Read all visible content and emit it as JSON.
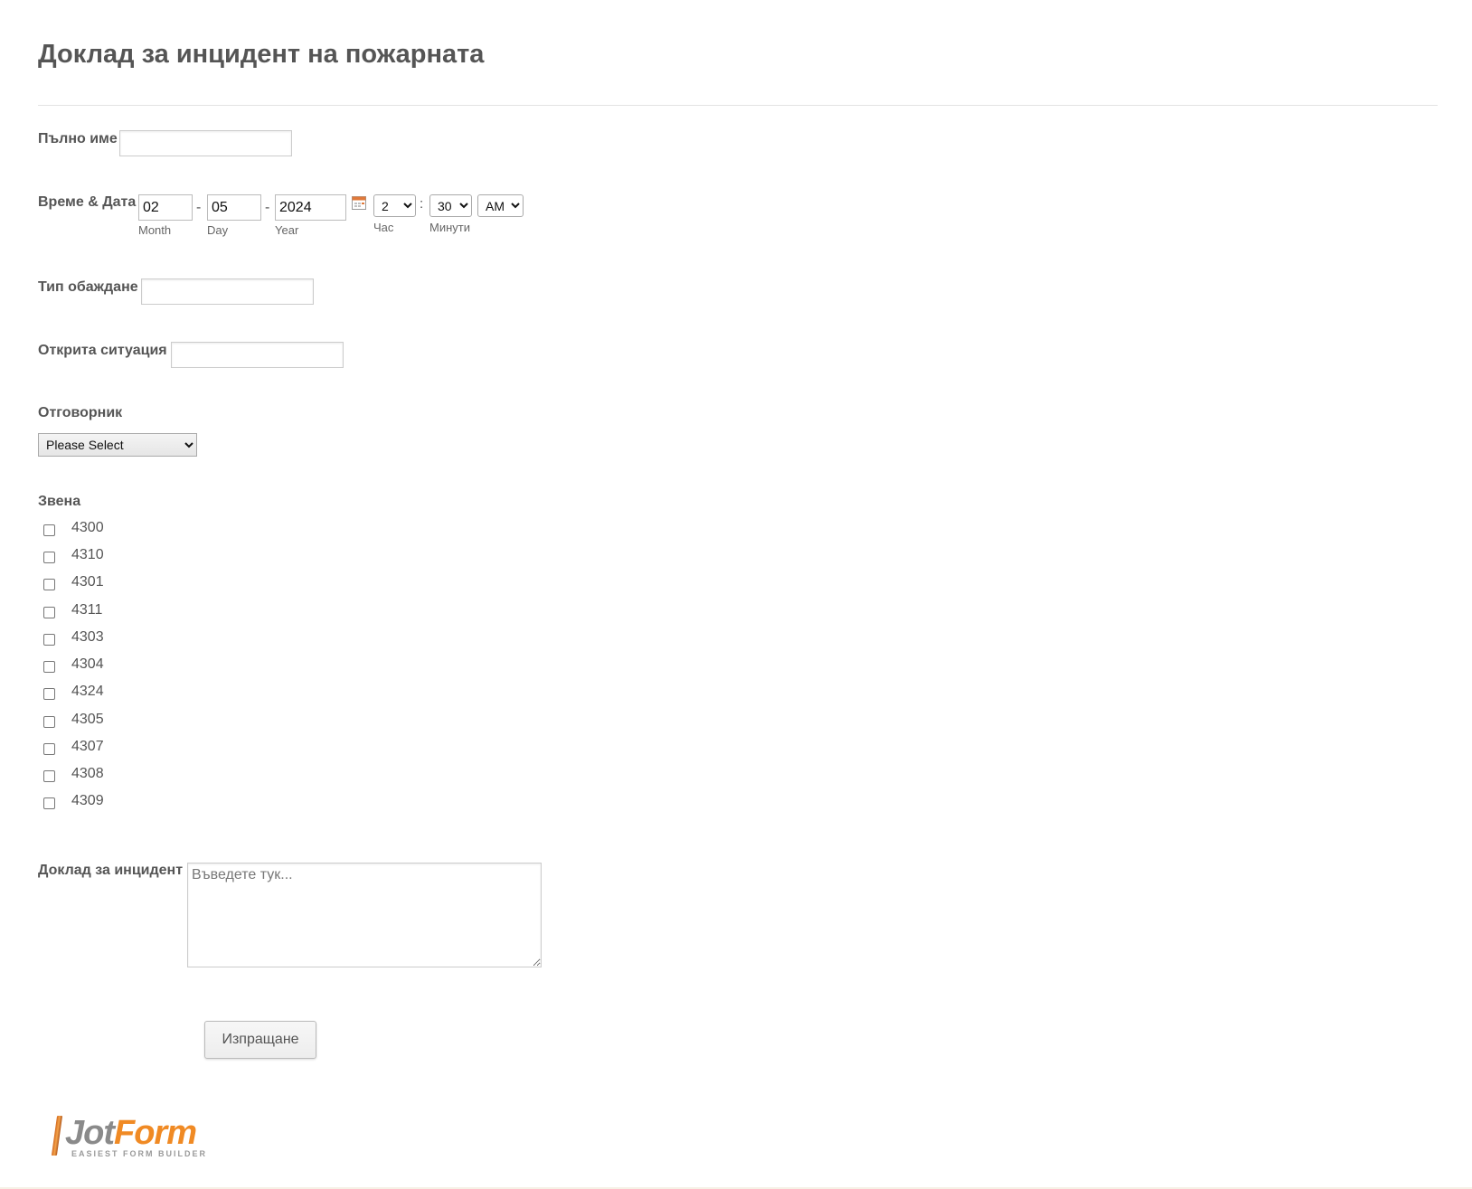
{
  "form": {
    "title": "Доклад за инцидент на пожарната"
  },
  "full_name": {
    "label": "Пълно име",
    "value": ""
  },
  "datetime": {
    "label": "Време & Дата",
    "month": "02",
    "day": "05",
    "year": "2024",
    "separator": "-",
    "month_label": "Month",
    "day_label": "Day",
    "year_label": "Year",
    "hour": "2",
    "minute": "30",
    "ampm": "AM",
    "time_separator": ":",
    "hour_label": "Час",
    "minute_label": "Минути",
    "calendar_icon": "calendar-icon"
  },
  "call_type": {
    "label": "Тип обаждане",
    "value": ""
  },
  "situation_found": {
    "label": "Открита ситуация",
    "value": ""
  },
  "responder": {
    "label": "Отговорник",
    "selected": "Please Select"
  },
  "units": {
    "label": "Звена",
    "options": [
      "4300",
      "4310",
      "4301",
      "4311",
      "4303",
      "4304",
      "4324",
      "4305",
      "4307",
      "4308",
      "4309"
    ],
    "checked": [
      false,
      false,
      false,
      false,
      false,
      false,
      false,
      false,
      false,
      false,
      false
    ]
  },
  "incident_report": {
    "label": "Доклад за инцидент",
    "placeholder": "Въведете тук...",
    "value": ""
  },
  "submit": {
    "label": "Изпращане"
  },
  "branding": {
    "logo_jot": "Jot",
    "logo_form": "Form",
    "logo_tagline": "EASIEST FORM BUILDER",
    "accent_color": "#f08a24"
  }
}
